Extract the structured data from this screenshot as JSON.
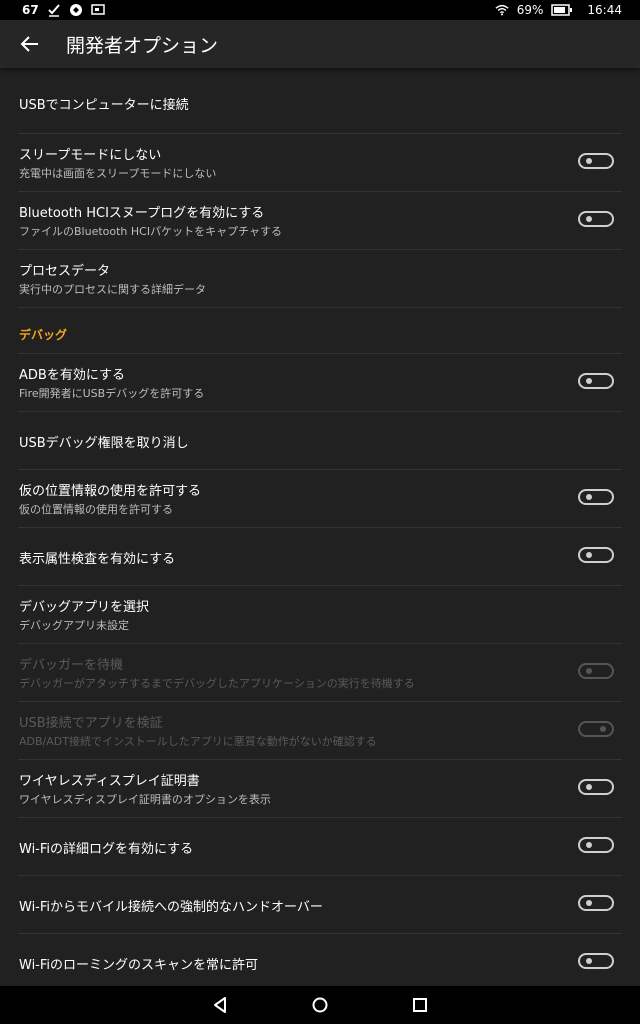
{
  "status_bar": {
    "notification_count": "67",
    "battery_percent": "69%",
    "time": "16:44",
    "icons": [
      "check-icon",
      "circle-app-icon",
      "screen-icon",
      "wifi-icon",
      "battery-icon"
    ]
  },
  "header": {
    "title": "開発者オプション"
  },
  "rows": [
    {
      "title": "USBでコンピューターに接続",
      "subtitle": ""
    },
    {
      "title": "スリープモードにしない",
      "subtitle": "充電中は画面をスリープモードにしない",
      "toggle": "off"
    },
    {
      "title": "Bluetooth HCIスヌープログを有効にする",
      "subtitle": "ファイルのBluetooth HCIパケットをキャプチャする",
      "toggle": "off"
    },
    {
      "title": "プロセスデータ",
      "subtitle": "実行中のプロセスに関する詳細データ"
    }
  ],
  "section": {
    "label": "デバッグ"
  },
  "debug_rows": [
    {
      "title": "ADBを有効にする",
      "subtitle": "Fire開発者にUSBデバッグを許可する",
      "toggle": "off"
    },
    {
      "title": "USBデバッグ権限を取り消し",
      "subtitle": ""
    },
    {
      "title": "仮の位置情報の使用を許可する",
      "subtitle": "仮の位置情報の使用を許可する",
      "toggle": "off"
    },
    {
      "title": "表示属性検査を有効にする",
      "subtitle": "",
      "toggle": "off"
    },
    {
      "title": "デバッグアプリを選択",
      "subtitle": "デバッグアプリ未設定"
    },
    {
      "title": "デバッガーを待機",
      "subtitle": "デバッガーがアタッチするまでデバッグしたアプリケーションの実行を待機する",
      "toggle": "off",
      "disabled": true
    },
    {
      "title": "USB接続でアプリを検証",
      "subtitle": "ADB/ADT接続でインストールしたアプリに悪質な動作がないか確認する",
      "toggle": "on",
      "disabled": true
    },
    {
      "title": "ワイヤレスディスプレイ証明書",
      "subtitle": "ワイヤレスディスプレイ証明書のオプションを表示",
      "toggle": "off"
    },
    {
      "title": "Wi-Fiの詳細ログを有効にする",
      "subtitle": "",
      "toggle": "off"
    },
    {
      "title": "Wi-Fiからモバイル接続への強制的なハンドオーバー",
      "subtitle": "",
      "toggle": "off"
    },
    {
      "title": "Wi-Fiのローミングのスキャンを常に許可",
      "subtitle": "",
      "toggle": "off"
    }
  ],
  "colors": {
    "background": "#212121",
    "accent": "#f5a623",
    "divider": "#333333"
  }
}
